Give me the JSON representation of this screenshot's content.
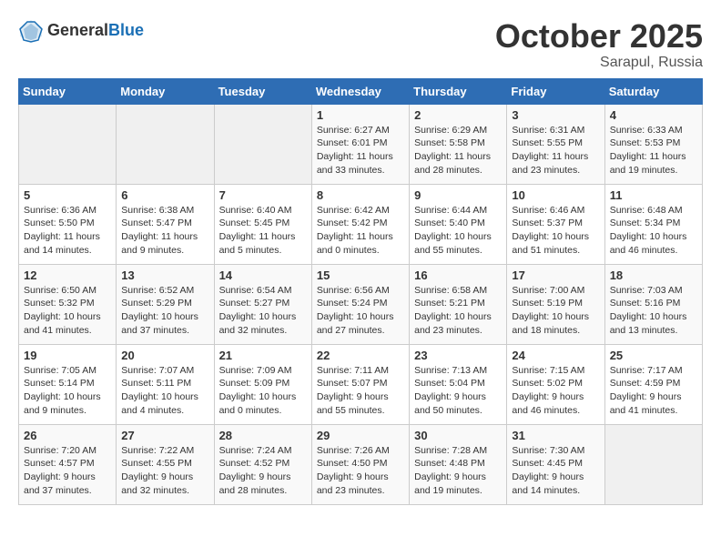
{
  "logo": {
    "general": "General",
    "blue": "Blue"
  },
  "title": "October 2025",
  "location": "Sarapul, Russia",
  "weekdays": [
    "Sunday",
    "Monday",
    "Tuesday",
    "Wednesday",
    "Thursday",
    "Friday",
    "Saturday"
  ],
  "weeks": [
    [
      {
        "day": null,
        "details": null
      },
      {
        "day": null,
        "details": null
      },
      {
        "day": null,
        "details": null
      },
      {
        "day": "1",
        "details": "Sunrise: 6:27 AM\nSunset: 6:01 PM\nDaylight: 11 hours\nand 33 minutes."
      },
      {
        "day": "2",
        "details": "Sunrise: 6:29 AM\nSunset: 5:58 PM\nDaylight: 11 hours\nand 28 minutes."
      },
      {
        "day": "3",
        "details": "Sunrise: 6:31 AM\nSunset: 5:55 PM\nDaylight: 11 hours\nand 23 minutes."
      },
      {
        "day": "4",
        "details": "Sunrise: 6:33 AM\nSunset: 5:53 PM\nDaylight: 11 hours\nand 19 minutes."
      }
    ],
    [
      {
        "day": "5",
        "details": "Sunrise: 6:36 AM\nSunset: 5:50 PM\nDaylight: 11 hours\nand 14 minutes."
      },
      {
        "day": "6",
        "details": "Sunrise: 6:38 AM\nSunset: 5:47 PM\nDaylight: 11 hours\nand 9 minutes."
      },
      {
        "day": "7",
        "details": "Sunrise: 6:40 AM\nSunset: 5:45 PM\nDaylight: 11 hours\nand 5 minutes."
      },
      {
        "day": "8",
        "details": "Sunrise: 6:42 AM\nSunset: 5:42 PM\nDaylight: 11 hours\nand 0 minutes."
      },
      {
        "day": "9",
        "details": "Sunrise: 6:44 AM\nSunset: 5:40 PM\nDaylight: 10 hours\nand 55 minutes."
      },
      {
        "day": "10",
        "details": "Sunrise: 6:46 AM\nSunset: 5:37 PM\nDaylight: 10 hours\nand 51 minutes."
      },
      {
        "day": "11",
        "details": "Sunrise: 6:48 AM\nSunset: 5:34 PM\nDaylight: 10 hours\nand 46 minutes."
      }
    ],
    [
      {
        "day": "12",
        "details": "Sunrise: 6:50 AM\nSunset: 5:32 PM\nDaylight: 10 hours\nand 41 minutes."
      },
      {
        "day": "13",
        "details": "Sunrise: 6:52 AM\nSunset: 5:29 PM\nDaylight: 10 hours\nand 37 minutes."
      },
      {
        "day": "14",
        "details": "Sunrise: 6:54 AM\nSunset: 5:27 PM\nDaylight: 10 hours\nand 32 minutes."
      },
      {
        "day": "15",
        "details": "Sunrise: 6:56 AM\nSunset: 5:24 PM\nDaylight: 10 hours\nand 27 minutes."
      },
      {
        "day": "16",
        "details": "Sunrise: 6:58 AM\nSunset: 5:21 PM\nDaylight: 10 hours\nand 23 minutes."
      },
      {
        "day": "17",
        "details": "Sunrise: 7:00 AM\nSunset: 5:19 PM\nDaylight: 10 hours\nand 18 minutes."
      },
      {
        "day": "18",
        "details": "Sunrise: 7:03 AM\nSunset: 5:16 PM\nDaylight: 10 hours\nand 13 minutes."
      }
    ],
    [
      {
        "day": "19",
        "details": "Sunrise: 7:05 AM\nSunset: 5:14 PM\nDaylight: 10 hours\nand 9 minutes."
      },
      {
        "day": "20",
        "details": "Sunrise: 7:07 AM\nSunset: 5:11 PM\nDaylight: 10 hours\nand 4 minutes."
      },
      {
        "day": "21",
        "details": "Sunrise: 7:09 AM\nSunset: 5:09 PM\nDaylight: 10 hours\nand 0 minutes."
      },
      {
        "day": "22",
        "details": "Sunrise: 7:11 AM\nSunset: 5:07 PM\nDaylight: 9 hours\nand 55 minutes."
      },
      {
        "day": "23",
        "details": "Sunrise: 7:13 AM\nSunset: 5:04 PM\nDaylight: 9 hours\nand 50 minutes."
      },
      {
        "day": "24",
        "details": "Sunrise: 7:15 AM\nSunset: 5:02 PM\nDaylight: 9 hours\nand 46 minutes."
      },
      {
        "day": "25",
        "details": "Sunrise: 7:17 AM\nSunset: 4:59 PM\nDaylight: 9 hours\nand 41 minutes."
      }
    ],
    [
      {
        "day": "26",
        "details": "Sunrise: 7:20 AM\nSunset: 4:57 PM\nDaylight: 9 hours\nand 37 minutes."
      },
      {
        "day": "27",
        "details": "Sunrise: 7:22 AM\nSunset: 4:55 PM\nDaylight: 9 hours\nand 32 minutes."
      },
      {
        "day": "28",
        "details": "Sunrise: 7:24 AM\nSunset: 4:52 PM\nDaylight: 9 hours\nand 28 minutes."
      },
      {
        "day": "29",
        "details": "Sunrise: 7:26 AM\nSunset: 4:50 PM\nDaylight: 9 hours\nand 23 minutes."
      },
      {
        "day": "30",
        "details": "Sunrise: 7:28 AM\nSunset: 4:48 PM\nDaylight: 9 hours\nand 19 minutes."
      },
      {
        "day": "31",
        "details": "Sunrise: 7:30 AM\nSunset: 4:45 PM\nDaylight: 9 hours\nand 14 minutes."
      },
      {
        "day": null,
        "details": null
      }
    ]
  ]
}
